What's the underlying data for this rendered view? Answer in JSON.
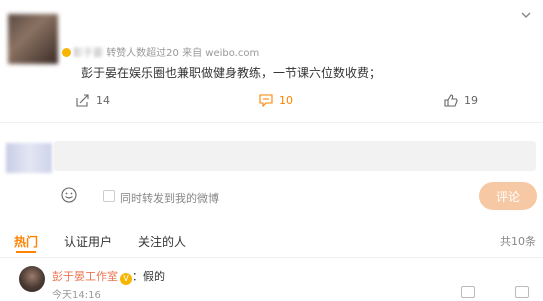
{
  "post": {
    "meta_prefix": "彭于晏",
    "repost_note": "转赞人数超过20",
    "source": "来自 weibo.com",
    "text": "彭于晏在娱乐圈也兼职做健身教练，一节课六位数收费；",
    "actions": {
      "share_count": "14",
      "comment_count": "10",
      "like_count": "19"
    }
  },
  "reply": {
    "repost_label": "同时转发到我的微博",
    "submit_label": "评论"
  },
  "tabs": {
    "hot": "热门",
    "verified": "认证用户",
    "following": "关注的人"
  },
  "comments_total": "共10条",
  "comment": {
    "author": "彭于晏工作室",
    "separator": "：",
    "text": "假的",
    "time": "今天14:16"
  },
  "colors": {
    "accent": "#ff8200",
    "author_link": "#eb7350",
    "submit_disabled": "#f7c8a4"
  },
  "icons": {
    "chevron": "chevron-down-icon",
    "share": "share-icon",
    "comment": "comment-icon",
    "like": "like-icon",
    "emoji": "emoji-icon"
  }
}
